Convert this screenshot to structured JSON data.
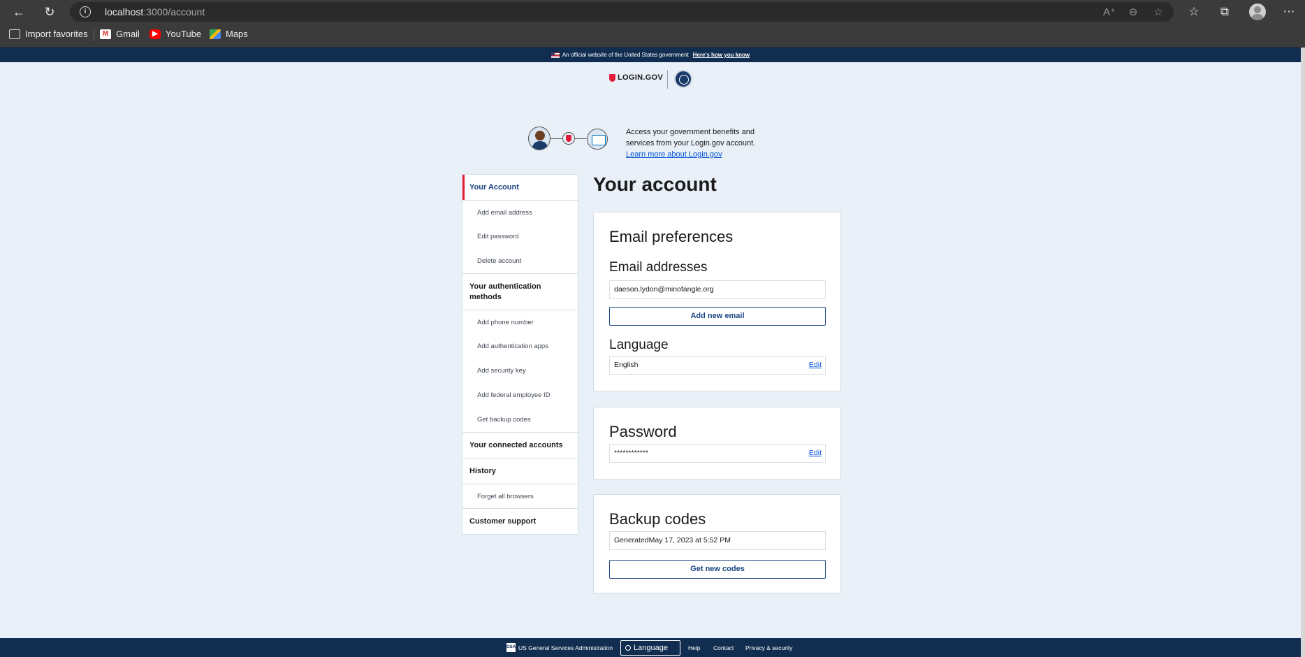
{
  "browser": {
    "url_host": "localhost",
    "url_path": ":3000/account",
    "bookmarks": [
      {
        "label": "Import favorites"
      },
      {
        "label": "Gmail"
      },
      {
        "label": "YouTube"
      },
      {
        "label": "Maps"
      }
    ]
  },
  "gov_banner": {
    "text": "An official website of the United States government",
    "link": "Here's how you know"
  },
  "header": {
    "logo_text": "LOGIN.GOV"
  },
  "intro": {
    "text": "Access your government benefits and services from your Login.gov account.",
    "link": "Learn more about Login.gov"
  },
  "sidenav": {
    "items": [
      {
        "label": "Your Account"
      },
      {
        "label": "Add email address"
      },
      {
        "label": "Edit password"
      },
      {
        "label": "Delete account"
      },
      {
        "label": "Your authentication methods"
      },
      {
        "label": "Add phone number"
      },
      {
        "label": "Add authentication apps"
      },
      {
        "label": "Add security key"
      },
      {
        "label": "Add federal employee ID"
      },
      {
        "label": "Get backup codes"
      },
      {
        "label": "Your connected accounts"
      },
      {
        "label": "History"
      },
      {
        "label": "Forget all browsers"
      },
      {
        "label": "Customer support"
      }
    ]
  },
  "main": {
    "title": "Your account",
    "email_card": {
      "title": "Email preferences",
      "emails_heading": "Email addresses",
      "email_value": "daeson.lydon@minofangle.org",
      "add_email_button": "Add new email",
      "language_heading": "Language",
      "language_value": "English",
      "edit_label": "Edit"
    },
    "password_card": {
      "title": "Password",
      "password_value": "************",
      "edit_label": "Edit"
    },
    "backup_card": {
      "title": "Backup codes",
      "generated_text": "GeneratedMay 17, 2023 at 5:52 PM",
      "button": "Get new codes"
    }
  },
  "footer": {
    "gsa_text": "US General Services Administration",
    "gsa_logo_text": "GSA",
    "language_button": "Language",
    "links": [
      "Help",
      "Contact",
      "Privacy & security"
    ]
  }
}
